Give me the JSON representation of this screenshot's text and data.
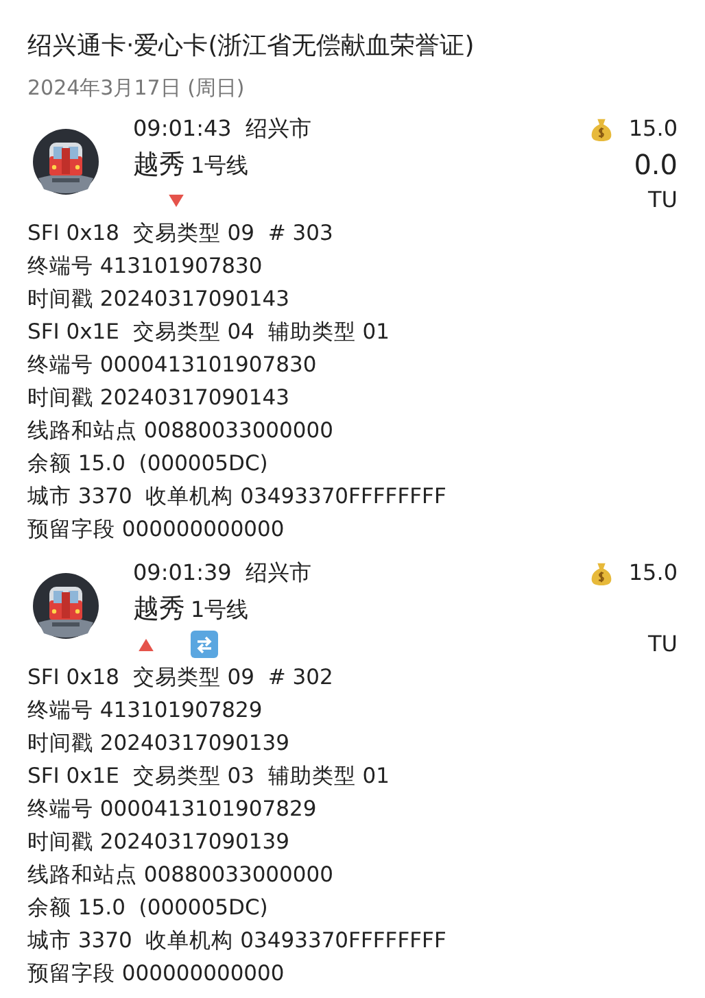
{
  "title": "绍兴通卡·爱心卡(浙江省无偿献血荣誉证)",
  "date": "2024年3月17日 (周日)",
  "records": [
    {
      "time": "09:01:43",
      "city": "绍兴市",
      "station": "越秀",
      "line": "1号线",
      "balance": "15.0",
      "amount": "0.0",
      "unit": "TU",
      "kind": "exit",
      "transfer": false,
      "details": [
        "SFI 0x18  交易类型 09  # 303",
        "终端号 413101907830",
        "时间戳 20240317090143",
        "SFI 0x1E  交易类型 04  辅助类型 01",
        "终端号 0000413101907830",
        "时间戳 20240317090143",
        "线路和站点 00880033000000",
        "余额 15.0  (000005DC)",
        "城市 3370  收单机构 03493370FFFFFFFF",
        "预留字段 000000000000"
      ]
    },
    {
      "time": "09:01:39",
      "city": "绍兴市",
      "station": "越秀",
      "line": "1号线",
      "balance": "15.0",
      "unit": "TU",
      "kind": "entry",
      "transfer": true,
      "details": [
        "SFI 0x18  交易类型 09  # 302",
        "终端号 413101907829",
        "时间戳 20240317090139",
        "SFI 0x1E  交易类型 03  辅助类型 01",
        "终端号 0000413101907829",
        "时间戳 20240317090139",
        "线路和站点 00880033000000",
        "余额 15.0  (000005DC)",
        "城市 3370  收单机构 03493370FFFFFFFF",
        "预留字段 000000000000"
      ]
    }
  ]
}
